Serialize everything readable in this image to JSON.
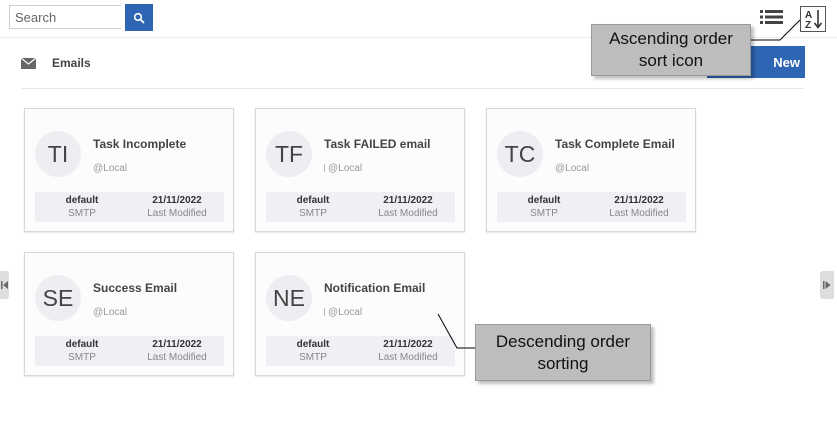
{
  "search": {
    "placeholder": "Search",
    "button_icon": "search-icon"
  },
  "toolbar": {
    "list_view_icon": "list-view-icon",
    "sort_icon": "sort-az-icon"
  },
  "section": {
    "icon": "mail-icon",
    "title": "Emails",
    "new_button_label": "New"
  },
  "cards": [
    {
      "initials": "TI",
      "title": "Task Incomplete",
      "subtitle": "@Local",
      "type_value": "default",
      "type_label": "SMTP",
      "date_value": "21/11/2022",
      "date_label": "Last Modified",
      "sub_tick": false
    },
    {
      "initials": "TF",
      "title": "Task FAILED email",
      "subtitle": "@Local",
      "type_value": "default",
      "type_label": "SMTP",
      "date_value": "21/11/2022",
      "date_label": "Last Modified",
      "sub_tick": true
    },
    {
      "initials": "TC",
      "title": "Task Complete Email",
      "subtitle": "@Local",
      "type_value": "default",
      "type_label": "SMTP",
      "date_value": "21/11/2022",
      "date_label": "Last Modified",
      "sub_tick": false
    },
    {
      "initials": "SE",
      "title": "Success Email",
      "subtitle": "@Local",
      "type_value": "default",
      "type_label": "SMTP",
      "date_value": "21/11/2022",
      "date_label": "Last Modified",
      "sub_tick": false
    },
    {
      "initials": "NE",
      "title": "Notification Email",
      "subtitle": "@Local",
      "type_value": "default",
      "type_label": "SMTP",
      "date_value": "21/11/2022",
      "date_label": "Last Modified",
      "sub_tick": true
    }
  ],
  "annotations": {
    "ascending_line1": "Ascending order",
    "ascending_line2": "sort icon",
    "descending_line1": "Descending order",
    "descending_line2": "sorting"
  },
  "colors": {
    "accent": "#2f66b3",
    "callout": "#bdbdbd",
    "card_meta": "#eef0f4"
  }
}
